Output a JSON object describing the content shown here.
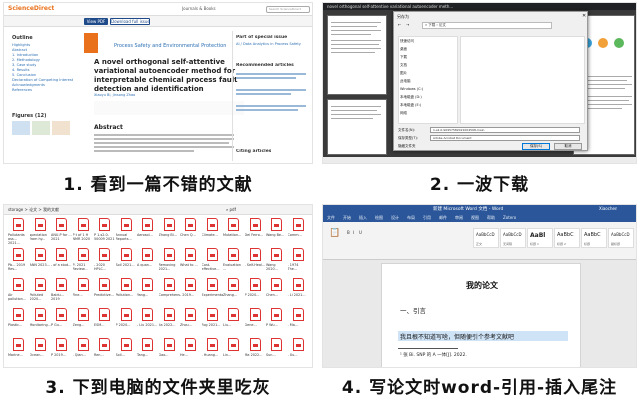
{
  "captions": [
    "1. 看到一篇不错的文献",
    "2. 一波下载",
    "3. 下到电脑的文件夹里吃灰",
    "4. 写论文时word-引用-插入尾注"
  ],
  "panel1": {
    "site_logo": "ScienceDirect",
    "nav": "Journals & Books",
    "search_placeholder": "Search ScienceDirect",
    "view_pdf": "View PDF",
    "download_full_issue": "Download full issue",
    "outline_title": "Outline",
    "outline_items": [
      "Highlights",
      "Abstract",
      "1. Introduction",
      "2. Methodology",
      "3. Case study",
      "4. Results",
      "5. Conclusion",
      "Declaration of Competing Interest",
      "Acknowledgments",
      "References"
    ],
    "figures_title": "Figures (12)",
    "journal": "Process Safety and Environmental Protection",
    "article_title": "A novel orthogonal self-attentive variational autoencoder method for interpretable chemical process fault detection and identification",
    "authors": "Xiaoyu Bi, Jinsong Zhao",
    "abstract_heading": "Abstract",
    "side_heading_1": "Part of special issue",
    "side_link_1": "AI / Data Analytics in Process Safety",
    "side_heading_2": "Recommended articles",
    "side_heading_3": "Citing articles"
  },
  "panel2": {
    "browser_title": "novel orthogonal self-attentive variational autoencoder meth...",
    "dialog_title": "另存为",
    "path": "« 下载 › 论文",
    "sidebar_items": [
      "快速访问",
      "桌面",
      "下载",
      "文档",
      "图片",
      "此电脑",
      "Windows (C:)",
      "本地磁盘 (D:)",
      "本地磁盘 (E:)",
      "网络"
    ],
    "file_name_label": "文件名(N):",
    "file_name_value": "1-s2.0-S0957582021004598-main",
    "save_type_label": "保存类型(T):",
    "save_type_value": "Adobe Acrobat Document",
    "hide_folders": "隐藏文件夹",
    "save_button": "保存(S)",
    "cancel_button": "取消"
  },
  "panel3": {
    "path": "storage > 论文 > 我的文献",
    "search": "pdf",
    "files": [
      "Pollutants ass... 2021...",
      "speciation from hy...",
      "ANU-P for ... 2021",
      "P t of 1 H NMR 2020",
      "P 1-s2.0-50009 2021",
      "Annual Reports...",
      "Aerosol...",
      "Zhang Bi...",
      "Chen Q...",
      "Climate...",
      "Mutation...",
      "Del Ferro...",
      "Wang Be...",
      "Comm...",
      "Pb... 2019 Rev...",
      "ANN 2023...",
      "- of a stud...",
      "P- 2021 Review...",
      "- 2020 HPLC...",
      "Soil 2021...",
      "A quan...",
      "Removing 2021...",
      "What to ...",
      "Cost-effective...",
      "Evaluation ...",
      "- Self-Heal...",
      "Wang 2020...",
      "- 1974 The...",
      "Air pollution...",
      "Polluted 2020...",
      "Baidu... 2019",
      "Fine...",
      "Predictive...",
      "Pollution...",
      "Yang...",
      "Comprehensive...",
      "- 2019...",
      "Experimental...",
      "Zhang...",
      "P 2020...",
      "Chen...",
      "- Li 2021...",
      "Plastic...",
      "Monitoring...",
      "P Gu...",
      "Zeng...",
      "ESM...",
      "P 2020...",
      "- Liu 2021...",
      "Jia 2022...",
      "Zhou...",
      "Fog 2021...",
      "Liu...",
      "Gene...",
      "P Wu...",
      "- Ma...",
      "Marine...",
      "Ocean...",
      "P 2019...",
      "- Qian...",
      "Ren...",
      "Soil...",
      "Tang...",
      "Gao...",
      "He...",
      "- Huang...",
      "Lin...",
      "Ma 2022...",
      "Sun...",
      "- Xu..."
    ]
  },
  "panel4": {
    "title": "新建 Microsoft Word 文档 - Word",
    "user": "Xiaochen",
    "tabs": [
      "文件",
      "开始",
      "插入",
      "绘图",
      "设计",
      "布局",
      "引用",
      "邮件",
      "审阅",
      "视图",
      "帮助",
      "Zotero"
    ],
    "styles": [
      {
        "big": "AaBbCcD",
        "sub": "正文"
      },
      {
        "big": "AaBbCcD",
        "sub": "无间隔"
      },
      {
        "big": "AaBl",
        "sub": "标题 1"
      },
      {
        "big": "AaBbC",
        "sub": "标题 2"
      },
      {
        "big": "AaBbC",
        "sub": "标题"
      },
      {
        "big": "AaBbCcD",
        "sub": "副标题"
      }
    ],
    "doc_title": "我的论文",
    "heading": "一、引言",
    "body": "我且根不知道写啥，但随便引个参考文献吧",
    "endnote": "¹ 张 Bi. SNP 的 A 一体[J]. 2022."
  }
}
